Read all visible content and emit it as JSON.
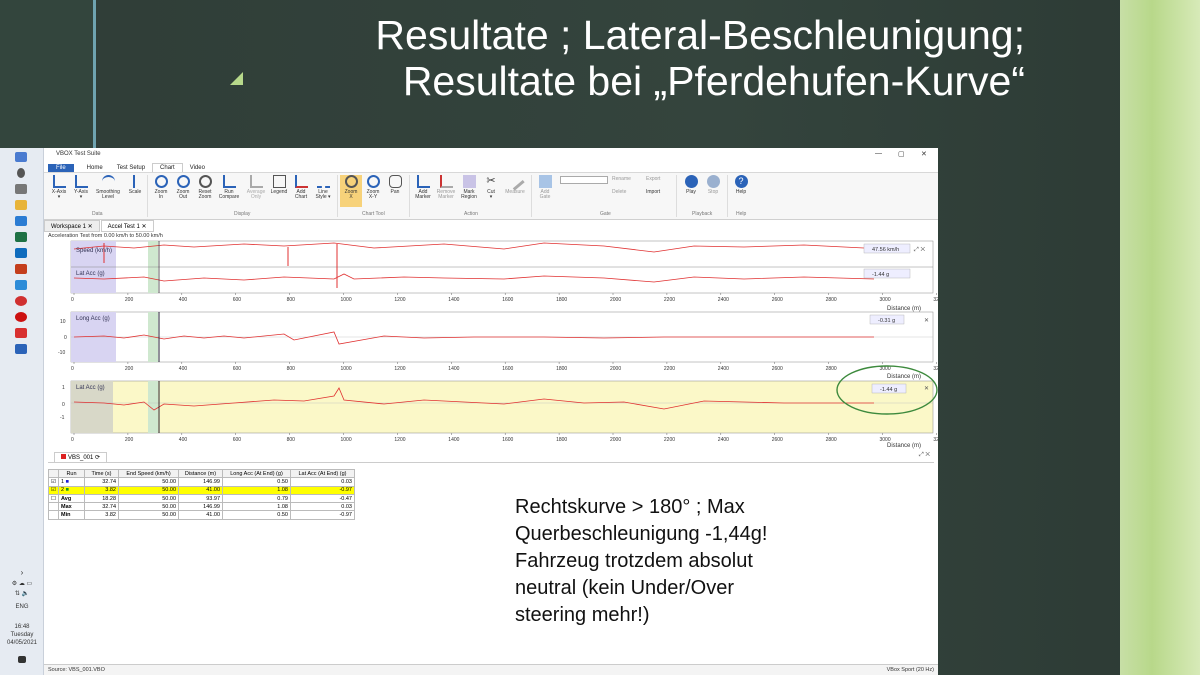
{
  "slide": {
    "title_line1": "Resultate ; Lateral-Beschleunigung;",
    "title_line2": "Resultate bei „Pferdehufen-Kurve“",
    "note_lines": [
      "Rechtskurve > 180° ; Max",
      "Querbeschleunigung -1,44g!",
      "Fahrzeug trotzdem absolut",
      "neutral (kein Under/Over",
      "steering mehr!)"
    ]
  },
  "taskbar": {
    "language": "ENG",
    "time": "16:48",
    "day": "Tuesday",
    "date": "04/05/2021"
  },
  "app": {
    "window_title": "VBOX Test Suite",
    "menu": {
      "file": "File",
      "tabs": [
        "Home",
        "Test Setup",
        "Chart",
        "Video"
      ]
    },
    "ribbon": {
      "buttons": [
        {
          "l1": "X-Axis",
          "l2": "▾"
        },
        {
          "l1": "Y-Axis",
          "l2": "▾"
        },
        {
          "l1": "Smoothing",
          "l2": "Level"
        },
        {
          "l1": "Scale",
          "l2": ""
        },
        {
          "l1": "Zoom",
          "l2": "In"
        },
        {
          "l1": "Zoom",
          "l2": "Out"
        },
        {
          "l1": "Reset",
          "l2": "Zoom"
        },
        {
          "l1": "Run",
          "l2": "Compare"
        },
        {
          "l1": "Average",
          "l2": "Only"
        },
        {
          "l1": "Legend",
          "l2": ""
        },
        {
          "l1": "Add",
          "l2": "Chart"
        },
        {
          "l1": "Line",
          "l2": "Style ▾"
        },
        {
          "l1": "Zoom",
          "l2": "X"
        },
        {
          "l1": "Zoom",
          "l2": "X-Y"
        },
        {
          "l1": "Pan",
          "l2": ""
        },
        {
          "l1": "Add",
          "l2": "Marker"
        },
        {
          "l1": "Remove",
          "l2": "Marker"
        },
        {
          "l1": "Mark",
          "l2": "Region"
        },
        {
          "l1": "Cut",
          "l2": "▾"
        },
        {
          "l1": "Measure",
          "l2": ""
        },
        {
          "l1": "Add",
          "l2": "Gate"
        },
        {
          "l1": "Play",
          "l2": ""
        },
        {
          "l1": "Stop",
          "l2": ""
        },
        {
          "l1": "Help",
          "l2": ""
        }
      ],
      "gate_actions": [
        "Rename",
        "Delete",
        "Export",
        "Import"
      ],
      "groups": [
        "Data",
        "Display",
        "Chart Tool",
        "Action",
        "Gate",
        "Playback",
        "Help"
      ]
    },
    "doc_tabs": [
      "Workspace 1",
      "Accel Test 1"
    ],
    "subtitle": "Acceleration Test from 0.00 km/h to 50.00 km/h",
    "axis_label": "Distance (m)",
    "charts": [
      {
        "labels": [
          "Speed (km/h)",
          "Lat Acc (g)"
        ],
        "values": [
          "47.56 km/h",
          "-1.44 g"
        ]
      },
      {
        "labels": [
          "Long Acc (g)"
        ],
        "values": [
          "-0.31 g"
        ],
        "y_ticks": [
          "10",
          "0",
          "-10"
        ]
      },
      {
        "labels": [
          "Lat Acc (g)"
        ],
        "values": [
          "-1.44 g"
        ],
        "y_ticks": [
          "1",
          "0",
          "-1"
        ]
      }
    ],
    "x_ticks": [
      "0",
      "200",
      "400",
      "600",
      "800",
      "1000",
      "1200",
      "1400",
      "1600",
      "1800",
      "2000",
      "2200",
      "2400",
      "2600",
      "2800",
      "3000",
      "3200"
    ],
    "run_panel": {
      "tab": "VBS_001",
      "columns": [
        "Run",
        "Time (s)",
        "End Speed (km/h)",
        "Distance (m)",
        "Long Acc (At End) (g)",
        "Lat Acc (At End) (g)"
      ],
      "rows": [
        {
          "run": "1",
          "time": "32.74",
          "speed": "50.00",
          "dist": "146.99",
          "long": "0.50",
          "lat": "0.03"
        },
        {
          "run": "2",
          "time": "3.82",
          "speed": "50.00",
          "dist": "41.00",
          "long": "1.08",
          "lat": "-0.97"
        },
        {
          "run": "Avg",
          "time": "18.28",
          "speed": "50.00",
          "dist": "93.97",
          "long": "0.79",
          "lat": "-0.47"
        },
        {
          "run": "Max",
          "time": "32.74",
          "speed": "50.00",
          "dist": "146.99",
          "long": "1.08",
          "lat": "0.03"
        },
        {
          "run": "Min",
          "time": "3.82",
          "speed": "50.00",
          "dist": "41.00",
          "long": "0.50",
          "lat": "-0.97"
        }
      ]
    },
    "status_left": "Source: VBS_001.VBO",
    "status_right": "VBox Sport (20 Hz)"
  }
}
